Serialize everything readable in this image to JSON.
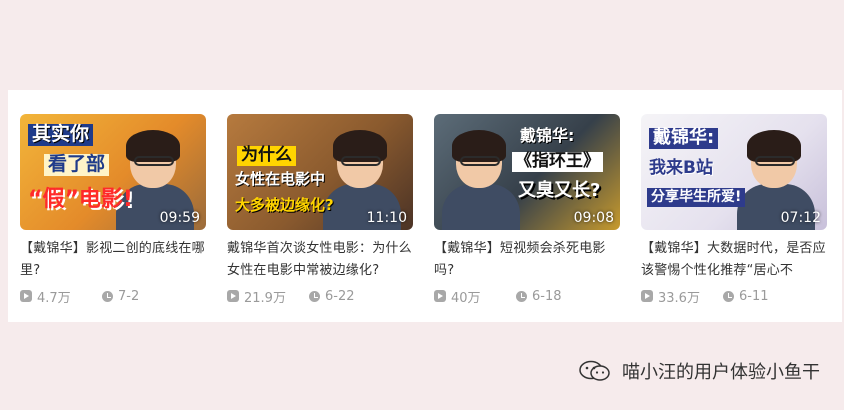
{
  "videos": [
    {
      "overlay_lines": [
        "其实你",
        "看了部",
        "“假”电影!"
      ],
      "duration": "09:59",
      "title": "【戴锦华】影视二创的底线在哪里?",
      "views": "4.7万",
      "date": "7-2"
    },
    {
      "overlay_lines": [
        "为什么",
        "女性在电影中",
        "大多被边缘化?"
      ],
      "duration": "11:10",
      "title": "戴锦华首次谈女性电影：为什么女性在电影中常被边缘化?",
      "views": "21.9万",
      "date": "6-22"
    },
    {
      "overlay_lines": [
        "戴锦华:",
        "《指环王》",
        "又臭又长?"
      ],
      "duration": "09:08",
      "title": "【戴锦华】短视频会杀死电影吗?",
      "views": "40万",
      "date": "6-18"
    },
    {
      "overlay_lines": [
        "戴锦华:",
        "我来B站",
        "分享毕生所爱!"
      ],
      "duration": "07:12",
      "title": "【戴锦华】大数据时代，是否应该警惕个性化推荐“居心不",
      "views": "33.6万",
      "date": "6-11"
    }
  ],
  "icons": {
    "views": "play-icon",
    "date": "clock-icon",
    "watermark": "wechat-icon"
  },
  "watermark": {
    "text": "喵小汪的用户体验小鱼干"
  },
  "colors": {
    "page_bg": "#f6ebec",
    "panel_bg": "#ffffff",
    "meta_text": "#9a9a9a",
    "title_text": "#333333"
  }
}
